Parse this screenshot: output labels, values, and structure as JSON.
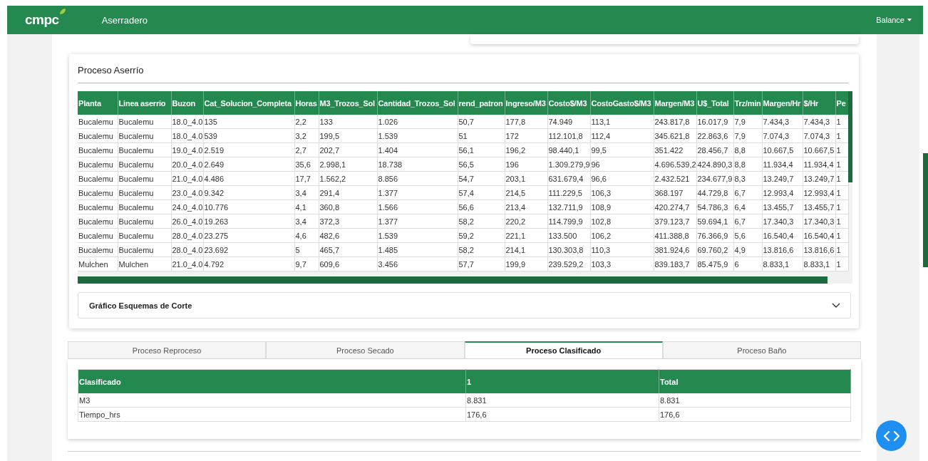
{
  "navbar": {
    "logo": "cmpc",
    "title": "Aserradero",
    "menu": "Balance"
  },
  "sawing_card": {
    "title": "Proceso Aserrío",
    "table": {
      "columns": [
        "Planta",
        "Linea aserrio",
        "Buzon",
        "Cat_Solucion_Completa",
        "Horas",
        "M3_Trozos_Sol",
        "Cantidad_Trozos_Sol",
        "rend_patron",
        "Ingreso/M3",
        "Costo$/M3",
        "CostoGasto$/M3",
        "Margen/M3",
        "U$_Total",
        "Trz/min",
        "Margen/Hr",
        "$/Hr",
        "Pe"
      ],
      "rows": [
        [
          "Bucalemu",
          "Bucalemu",
          "18.0_4.0",
          "135",
          "2,2",
          "133",
          "1.026",
          "50,7",
          "177,8",
          "74.949",
          "113,1",
          "243.817,8",
          "16.017,9",
          "7,9",
          "7.434,3",
          "7.434,3",
          "1"
        ],
        [
          "Bucalemu",
          "Bucalemu",
          "18.0_4.0",
          "539",
          "3,2",
          "199,5",
          "1.539",
          "51",
          "172",
          "112.101,8",
          "112,4",
          "345.621,8",
          "22.863,6",
          "7,9",
          "7.074,3",
          "7.074,3",
          "1"
        ],
        [
          "Bucalemu",
          "Bucalemu",
          "19.0_4.0",
          "2.519",
          "2,7",
          "202,7",
          "1.404",
          "56,1",
          "196,2",
          "98.440,1",
          "99,5",
          "351.422",
          "28.456,7",
          "8,8",
          "10.667,5",
          "10.667,5",
          "1"
        ],
        [
          "Bucalemu",
          "Bucalemu",
          "20.0_4.0",
          "2.649",
          "35,6",
          "2.998,1",
          "18.738",
          "56,5",
          "196",
          "1.309.279,9",
          "96",
          "4.696.539,2",
          "424.890,3",
          "8,8",
          "11.934,4",
          "11.934,4",
          "1"
        ],
        [
          "Bucalemu",
          "Bucalemu",
          "21.0_4.0",
          "4.486",
          "17,7",
          "1.562,2",
          "8.856",
          "54,7",
          "203,1",
          "631.679,4",
          "96,6",
          "2.432.521",
          "234.677,9",
          "8,3",
          "13.249,7",
          "13.249,7",
          "1"
        ],
        [
          "Bucalemu",
          "Bucalemu",
          "23.0_4.0",
          "9.342",
          "3,4",
          "291,4",
          "1.377",
          "57,4",
          "214,5",
          "111.229,5",
          "106,3",
          "368.197",
          "44.729,8",
          "6,7",
          "12.993,4",
          "12.993,4",
          "1"
        ],
        [
          "Bucalemu",
          "Bucalemu",
          "24.0_4.0",
          "10.776",
          "4,1",
          "360,8",
          "1.566",
          "56,6",
          "213,4",
          "132.711,9",
          "108,9",
          "420.274,7",
          "54.786,3",
          "6,4",
          "13.455,7",
          "13.455,7",
          "1"
        ],
        [
          "Bucalemu",
          "Bucalemu",
          "26.0_4.0",
          "19.263",
          "3,4",
          "372,3",
          "1.377",
          "58,2",
          "220,2",
          "114.799,9",
          "102,8",
          "379.123,7",
          "59.694,1",
          "6,7",
          "17.340,3",
          "17.340,3",
          "1"
        ],
        [
          "Bucalemu",
          "Bucalemu",
          "28.0_4.0",
          "23.275",
          "4,6",
          "482,6",
          "1.539",
          "59,2",
          "221,1",
          "133.500",
          "106,2",
          "411.388,8",
          "76.366,9",
          "5,6",
          "16.540,4",
          "16.540,4",
          "1"
        ],
        [
          "Bucalemu",
          "Bucalemu",
          "28.0_4.0",
          "23.692",
          "5",
          "465,7",
          "1.485",
          "58,2",
          "214,1",
          "130.303,8",
          "110,3",
          "381.924,6",
          "69.760,2",
          "4,9",
          "13.816,6",
          "13.816,6",
          "1"
        ],
        [
          "Mulchen",
          "Mulchen",
          "21.0_4.0",
          "4.792",
          "9,7",
          "609,6",
          "3.456",
          "57,7",
          "199,9",
          "239.529,2",
          "103,3",
          "839.183,7",
          "85.475,9",
          "6",
          "8.833,1",
          "8.833,1",
          "1"
        ]
      ]
    },
    "accordion": {
      "title": "Gráfico Esquemas de Corte",
      "expanded": false
    }
  },
  "tabs": [
    {
      "label": "Proceso Reproceso",
      "selected": false
    },
    {
      "label": "Proceso Secado",
      "selected": false
    },
    {
      "label": "Proceso Clasificado",
      "selected": true
    },
    {
      "label": "Proceso Baño",
      "selected": false
    }
  ],
  "classified_table": {
    "columns": [
      "Clasificado",
      "1",
      "Total"
    ],
    "rows": [
      [
        "M3",
        "8.831",
        "8.831"
      ],
      [
        "Tiempo_hrs",
        "176,6",
        "176,6"
      ]
    ]
  }
}
